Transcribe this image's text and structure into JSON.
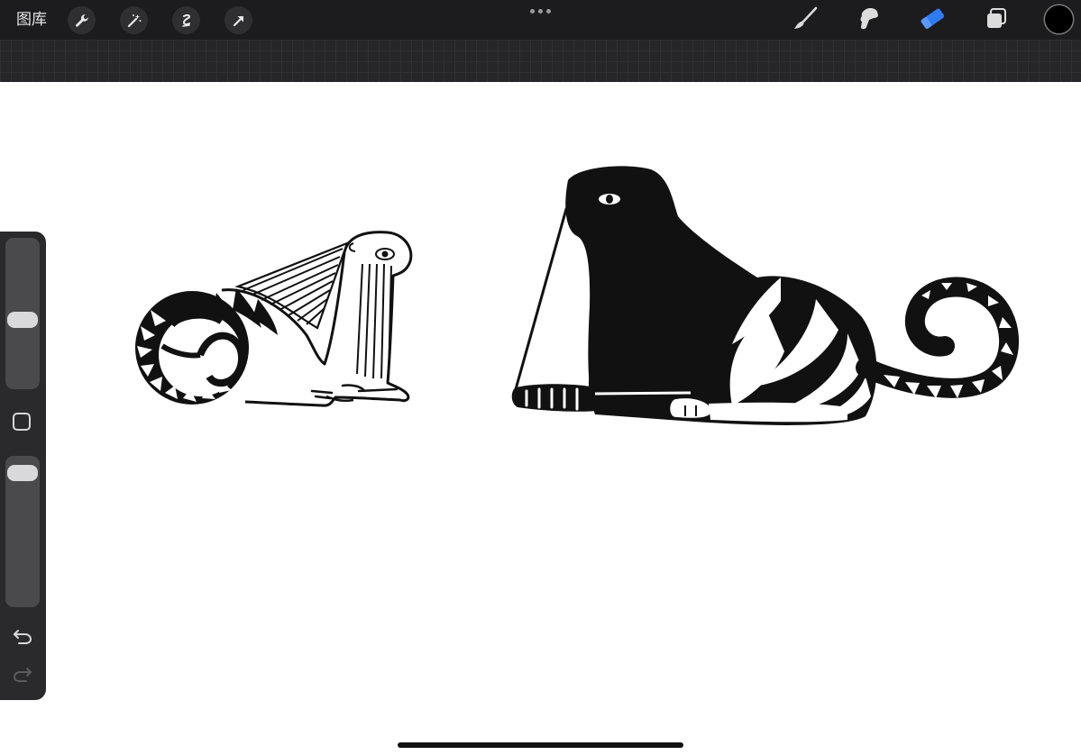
{
  "toolbar": {
    "gallery_label": "图库",
    "left_tools": [
      "wrench-icon",
      "magic-wand-icon",
      "selection-icon",
      "transform-arrow-icon"
    ],
    "center_icon": "more-dots-icon",
    "right_tools": [
      "brush-icon",
      "smudge-icon",
      "eraser-icon",
      "layers-icon"
    ],
    "active_tool": "eraser",
    "active_color": "#2f7bf5",
    "current_color": "#000000"
  },
  "sidebar": {
    "brush_size": 0.45,
    "opacity": 0.95,
    "icons": [
      "modify-square-icon",
      "undo-icon",
      "redo-icon"
    ]
  },
  "canvas": {
    "content": [
      "white-creature-drawing",
      "black-creature-drawing"
    ]
  }
}
